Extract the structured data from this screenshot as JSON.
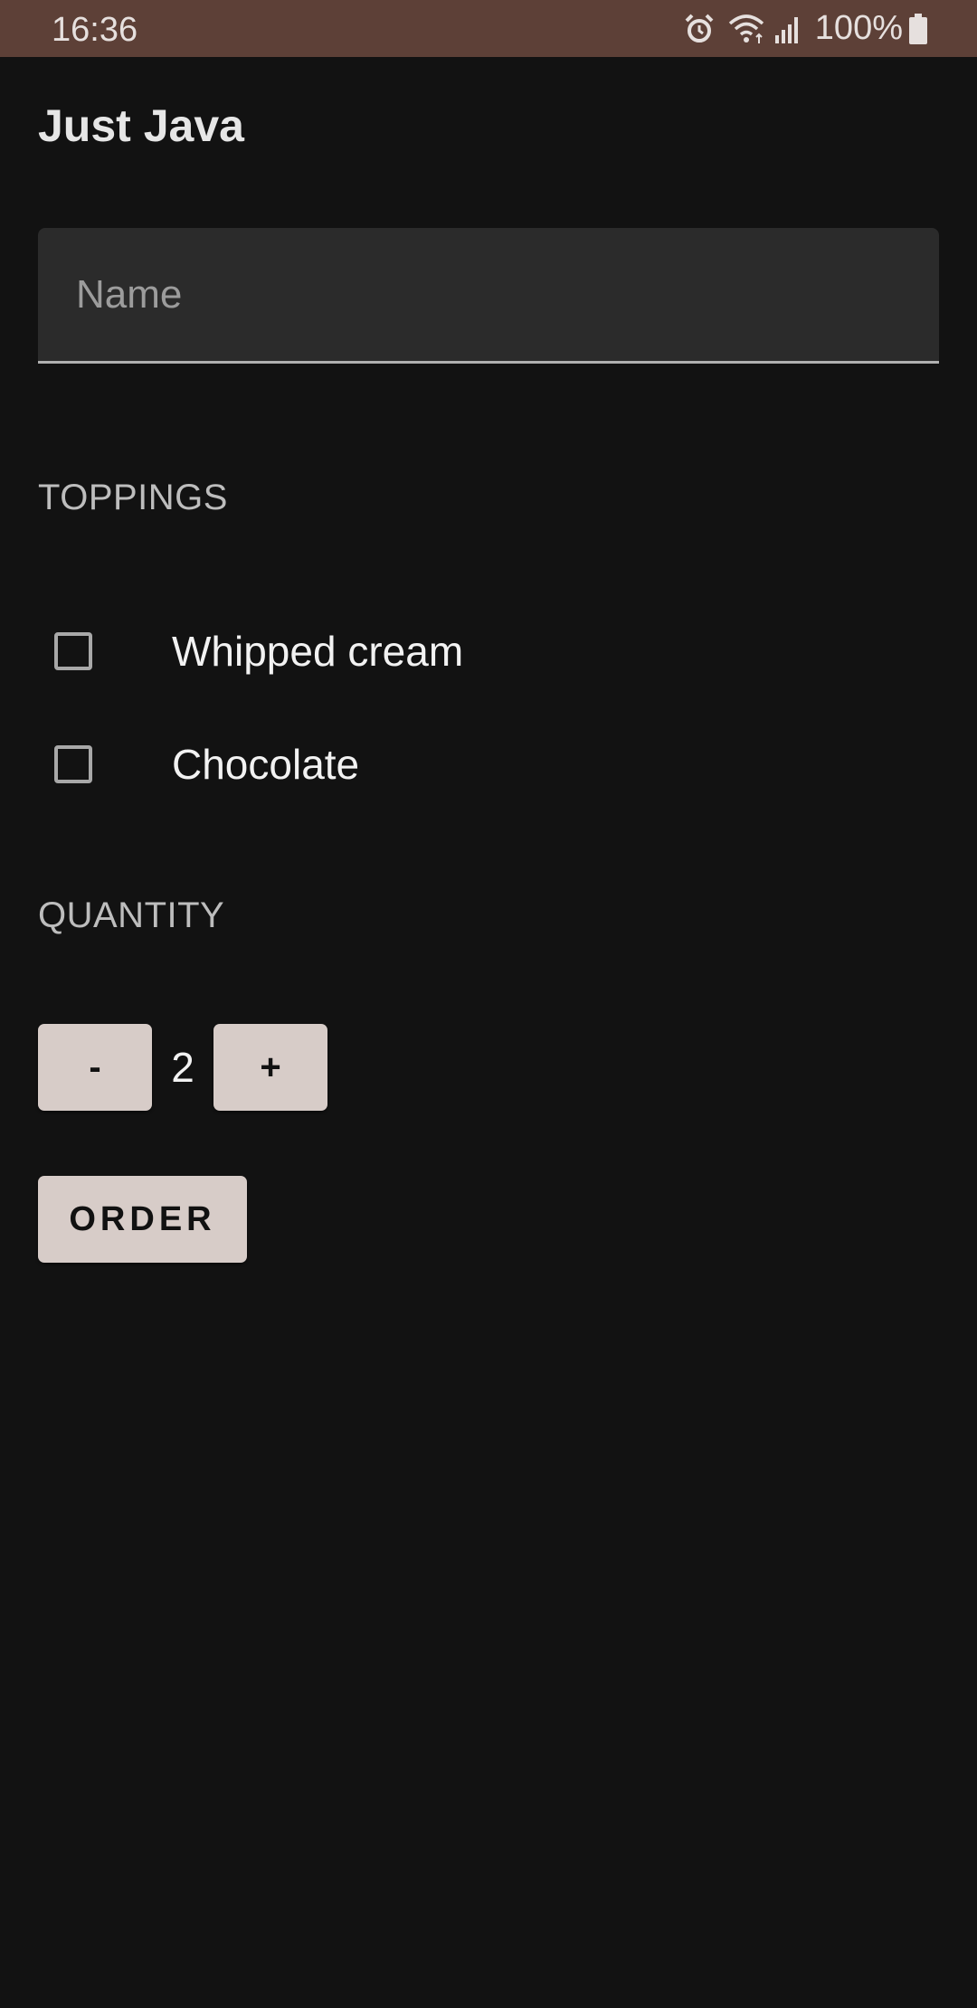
{
  "status_bar": {
    "time": "16:36",
    "battery": "100%",
    "icons": [
      "alarm-icon",
      "wifi-icon",
      "signal-icon",
      "battery-icon"
    ]
  },
  "app": {
    "title": "Just Java"
  },
  "name_field": {
    "placeholder": "Name",
    "value": ""
  },
  "toppings": {
    "header": "TOPPINGS",
    "items": [
      {
        "label": "Whipped cream",
        "checked": false
      },
      {
        "label": "Chocolate",
        "checked": false
      }
    ]
  },
  "quantity": {
    "header": "QUANTITY",
    "decrement_label": "-",
    "value": "2",
    "increment_label": "+"
  },
  "order_button": {
    "label": "ORDER"
  },
  "colors": {
    "status_bar": "#5d4037",
    "background": "#121212",
    "button": "#d7ccc8",
    "field": "#2b2b2b"
  }
}
